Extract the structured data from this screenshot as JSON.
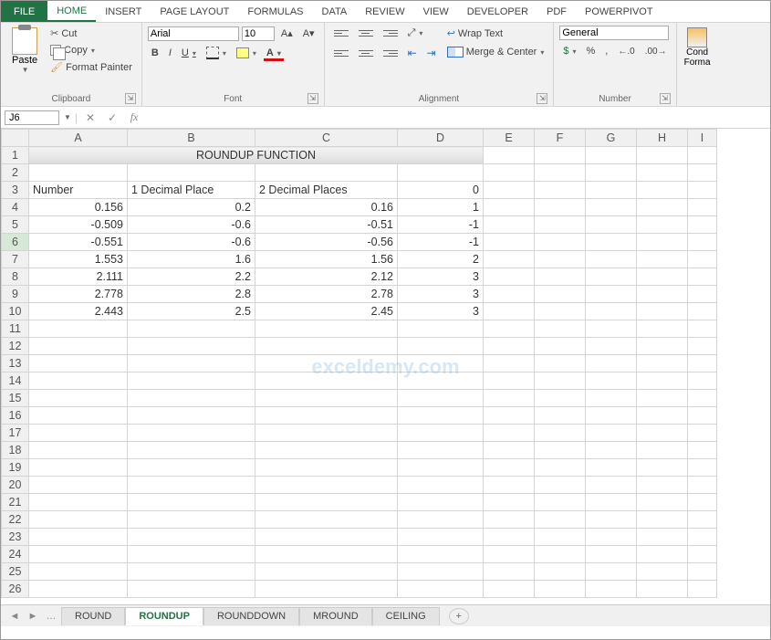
{
  "tabs": {
    "file": "FILE",
    "list": [
      "HOME",
      "INSERT",
      "PAGE LAYOUT",
      "FORMULAS",
      "DATA",
      "REVIEW",
      "VIEW",
      "DEVELOPER",
      "PDF",
      "POWERPIVOT"
    ],
    "active": "HOME"
  },
  "clipboard": {
    "paste": "Paste",
    "cut": "Cut",
    "copy": "Copy",
    "painter": "Format Painter",
    "label": "Clipboard"
  },
  "font": {
    "name": "Arial",
    "size": "10",
    "bold": "B",
    "italic": "I",
    "underline": "U",
    "colorLetter": "A",
    "label": "Font"
  },
  "alignment": {
    "wrap": "Wrap Text",
    "merge": "Merge & Center",
    "label": "Alignment"
  },
  "number": {
    "format": "General",
    "dollar": "$",
    "percent": "%",
    "comma": ",",
    "incDec": ".0←",
    "decDec": ".00→",
    "label": "Number"
  },
  "styles": {
    "cond": "Cond",
    "fmt": "Forma"
  },
  "fx": {
    "namebox": "J6",
    "cancel": "✕",
    "enter": "✓",
    "fx": "fx",
    "value": ""
  },
  "columns": [
    "A",
    "B",
    "C",
    "D",
    "E",
    "F",
    "G",
    "H",
    "I"
  ],
  "rowNums": [
    1,
    2,
    3,
    4,
    5,
    6,
    7,
    8,
    9,
    10,
    11,
    12,
    13,
    14,
    15,
    16,
    17,
    18,
    19,
    20,
    21,
    22,
    23,
    24,
    25,
    26
  ],
  "title": "ROUNDUP FUNCTION",
  "headers": {
    "a": "Number",
    "b": "1 Decimal Place",
    "c": "2 Decimal Places",
    "d": "0"
  },
  "data": [
    {
      "a": "0.156",
      "b": "0.2",
      "c": "0.16",
      "d": "1"
    },
    {
      "a": "-0.509",
      "b": "-0.6",
      "c": "-0.51",
      "d": "-1"
    },
    {
      "a": "-0.551",
      "b": "-0.6",
      "c": "-0.56",
      "d": "-1"
    },
    {
      "a": "1.553",
      "b": "1.6",
      "c": "1.56",
      "d": "2"
    },
    {
      "a": "2.111",
      "b": "2.2",
      "c": "2.12",
      "d": "3"
    },
    {
      "a": "2.778",
      "b": "2.8",
      "c": "2.78",
      "d": "3"
    },
    {
      "a": "2.443",
      "b": "2.5",
      "c": "2.45",
      "d": "3"
    }
  ],
  "sheets": {
    "list": [
      "ROUND",
      "ROUNDUP",
      "ROUNDDOWN",
      "MROUND",
      "CEILING"
    ],
    "active": "ROUNDUP",
    "new": "+"
  },
  "watermark": "exceldemy.com",
  "nav": {
    "first": "◄",
    "last": "►",
    "dots": "…"
  }
}
